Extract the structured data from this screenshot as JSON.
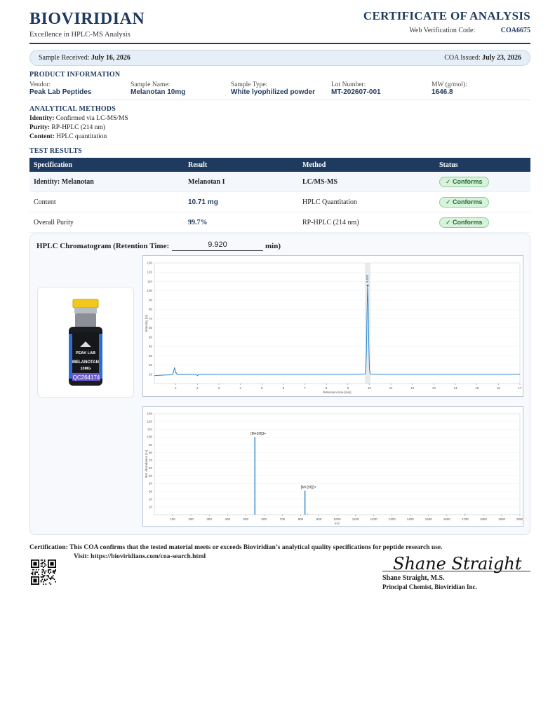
{
  "header": {
    "brand": "BIOVIRIDIAN",
    "tagline": "Excellence in HPLC-MS Analysis",
    "doc_title": "CERTIFICATE OF ANALYSIS",
    "verification_label": "Web Verification Code:",
    "verification_code": "COA6675"
  },
  "dates": {
    "received_label": "Sample Received:",
    "received_value": "July 16, 2026",
    "issued_label": "COA Issued:",
    "issued_value": "July 23, 2026"
  },
  "product": {
    "heading": "PRODUCT INFORMATION",
    "fields": [
      {
        "label": "Vendor:",
        "value": "Peak Lab Peptides"
      },
      {
        "label": "Sample Name:",
        "value": "Melanotan 10mg"
      },
      {
        "label": "Sample Type:",
        "value": "White lyophilized powder"
      },
      {
        "label": "Lot Number:",
        "value": "MT-202607-001"
      },
      {
        "label": "MW (g/mol):",
        "value": "1646.8"
      }
    ]
  },
  "methods": {
    "heading": "ANALYTICAL METHODS",
    "items": [
      {
        "label": "Identity:",
        "value": "Confirmed via LC-MS/MS"
      },
      {
        "label": "Purity:",
        "value": "RP-HPLC (214 nm)"
      },
      {
        "label": "Content:",
        "value": "HPLC quantitation"
      }
    ]
  },
  "results": {
    "heading": "TEST RESULTS",
    "columns": [
      "Specification",
      "Result",
      "Method",
      "Status"
    ],
    "rows": [
      {
        "spec": "Identity:  Melanotan",
        "result": "Melanotan I",
        "method": "LC/MS-MS",
        "status": "✓ Conforms"
      },
      {
        "spec": "Content",
        "result": "10.71  mg",
        "method": "HPLC Quantitation",
        "status": "✓ Conforms"
      },
      {
        "spec": "Overall Purity",
        "result": "99.7%",
        "method": "RP-HPLC (214 nm)",
        "status": "✓ Conforms"
      }
    ]
  },
  "chromatogram": {
    "label": "HPLC Chromatogram (Retention Time:",
    "retention_time": "9.920",
    "unit_suffix": "min)"
  },
  "vial": {
    "lines": [
      "PEAK LAB",
      "MELANOTAN",
      "10MG"
    ],
    "code": "QC264174"
  },
  "chart_data": [
    {
      "type": "line",
      "title": "",
      "xlabel": "Retention time [min]",
      "ylabel": "Intensity [%]",
      "xlim": [
        0,
        17
      ],
      "ylim": [
        0,
        130
      ],
      "x_ticks": [
        1,
        2,
        3,
        4,
        5,
        6,
        7,
        8,
        9,
        10,
        11,
        12,
        13,
        14,
        15,
        16,
        17
      ],
      "y_ticks": [
        10,
        20,
        30,
        40,
        50,
        60,
        70,
        80,
        90,
        100,
        110,
        120,
        130
      ],
      "peaks": [
        {
          "x": 0.95,
          "y": 18
        },
        {
          "x": 9.92,
          "y": 105,
          "label": "9.920"
        }
      ],
      "baseline": 10
    },
    {
      "type": "bar",
      "title": "",
      "xlabel": "m/z",
      "ylabel": "Rel. Abundance [%]",
      "xlim": [
        0,
        2000
      ],
      "ylim": [
        0,
        130
      ],
      "x_ticks": [
        100,
        200,
        300,
        400,
        500,
        600,
        700,
        800,
        900,
        1000,
        1100,
        1200,
        1300,
        1400,
        1500,
        1600,
        1700,
        1800,
        1900,
        2000
      ],
      "y_ticks": [
        10,
        20,
        30,
        40,
        50,
        60,
        70,
        80,
        90,
        100,
        110,
        120,
        130
      ],
      "peaks": [
        {
          "x": 550,
          "y": 100,
          "label": "[M+3H]3+"
        },
        {
          "x": 824,
          "y": 31,
          "label": "[M+2H]2+"
        }
      ]
    }
  ],
  "certification": {
    "statement": "Certification: This COA confirms that the tested material meets or exceeds Bioviridian’s analytical quality specifications for peptide research use.",
    "visit": "Visit: https://bioviridians.com/coa-search.html"
  },
  "signature": {
    "signature_text": "Shane Straight",
    "name": "Shane Straight, M.S.",
    "title": "Principal Chemist, Bioviridian Inc."
  },
  "colors": {
    "navy": "#1f3a5f",
    "accent": "#1a5fa8",
    "conform_bg": "#d8f2dc"
  }
}
